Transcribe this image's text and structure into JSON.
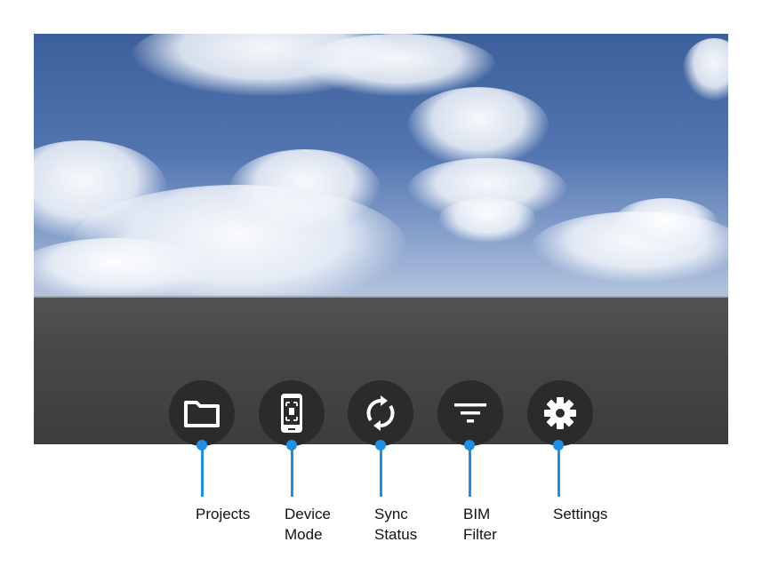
{
  "toolbar": {
    "projects": {
      "label": "Projects",
      "icon": "folder-icon"
    },
    "device_mode": {
      "label": "Device\nMode",
      "icon": "phone-scan-icon"
    },
    "sync_status": {
      "label": "Sync\nStatus",
      "icon": "sync-icon"
    },
    "bim_filter": {
      "label": "BIM\nFilter",
      "icon": "filter-icon"
    },
    "settings": {
      "label": "Settings",
      "icon": "gear-icon"
    }
  },
  "colors": {
    "callout": "#1e8fe6",
    "button_bg": "#2b2b2b",
    "icon": "#ffffff"
  }
}
